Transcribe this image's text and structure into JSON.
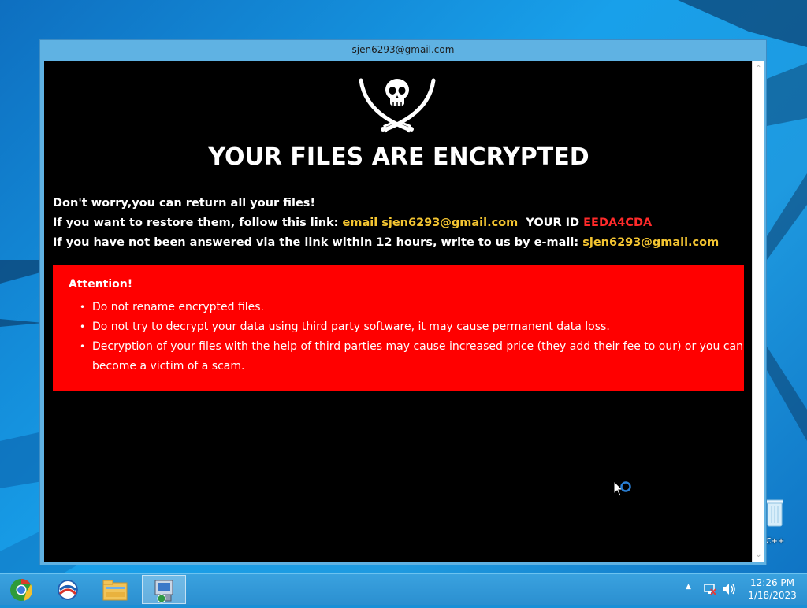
{
  "window": {
    "title": "sjen6293@gmail.com"
  },
  "ransom_note": {
    "headline": "YOUR FILES ARE ENCRYPTED",
    "line1": "Don't worry,you can return all your files!",
    "line2_prefix": "If you want to restore them, follow this link: ",
    "line2_email": "email sjen6293@gmail.com",
    "line2_id_label": "YOUR ID",
    "line2_id": "EEDA4CDA",
    "line3_prefix": "If you have not been answered via the link within 12 hours, write to us by e-mail: ",
    "line3_email": "sjen6293@gmail.com",
    "attention_title": "Attention!",
    "attention_items": [
      "Do not rename encrypted files.",
      "Do not try to decrypt your data using third party software, it may cause permanent data loss.",
      "Decryption of your files with the help of third parties may cause increased price (they add their fee to our) or you can become a victim of a scam."
    ]
  },
  "desktop": {
    "recycle_bin_label": "n C++"
  },
  "taskbar": {
    "apps": [
      {
        "name": "chrome-icon"
      },
      {
        "name": "outlook-icon"
      },
      {
        "name": "file-explorer-icon"
      },
      {
        "name": "installer-icon",
        "active": true
      }
    ],
    "clock_time": "12:26 PM",
    "clock_date": "1/18/2023"
  },
  "colors": {
    "note_background": "#000000",
    "attention_background": "#ff0000",
    "email_highlight": "#f4c531",
    "id_highlight": "#ff2a2a"
  }
}
